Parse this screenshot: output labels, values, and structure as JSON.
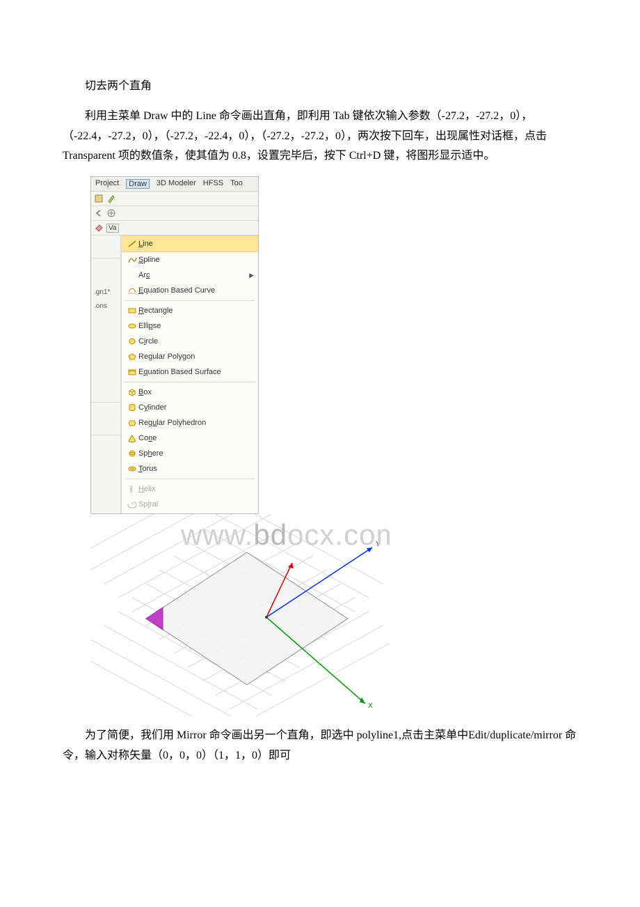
{
  "heading": "切去两个直角",
  "para1": "利用主菜单 Draw 中的 Line 命令画出直角，即利用 Tab 键依次输入参数（-27.2，-27.2，0），（-22.4，-27.2，0），（-27.2，-22.4，0），（-27.2，-27.2，0），两次按下回车，出现属性对话框，点击 Transparent 项的数值条，使其值为 0.8，设置完毕后，按下 Ctrl+D 键，将图形显示适中。",
  "para2": "为了简便，我们用 Mirror 命令画出另一个直角，即选中 polyline1,点击主菜单中Edit/duplicate/mirror 命令，输入对称矢量（0，0，0）（1，1，0）即可",
  "menubar": {
    "items": [
      "Project",
      "Draw",
      "3D Modeler",
      "HFSS",
      "Too"
    ],
    "active_index": 1
  },
  "left_col": {
    "top": [
      "Va"
    ],
    "files": [
      ".gn1*",
      ".ons"
    ]
  },
  "dropdown": {
    "groups": [
      {
        "items": [
          {
            "icon": "line-icon",
            "label": "Line",
            "highlight": true
          },
          {
            "icon": "spline-icon",
            "label": "Spline"
          },
          {
            "icon": "arc-icon",
            "label": "Arc",
            "submenu": true,
            "no_icon": true
          },
          {
            "icon": "eqcurve-icon",
            "label": "Equation Based Curve"
          }
        ]
      },
      {
        "items": [
          {
            "icon": "rect-icon",
            "label": "Rectangle"
          },
          {
            "icon": "ellipse-icon",
            "label": "Ellipse"
          },
          {
            "icon": "circle-icon",
            "label": "Circle"
          },
          {
            "icon": "regpoly-icon",
            "label": "Regular Polygon"
          },
          {
            "icon": "eqsurf-icon",
            "label": "Equation Based Surface"
          }
        ]
      },
      {
        "items": [
          {
            "icon": "box-icon",
            "label": "Box"
          },
          {
            "icon": "cyl-icon",
            "label": "Cylinder"
          },
          {
            "icon": "regpolyh-icon",
            "label": "Regular Polyhedron"
          },
          {
            "icon": "cone-icon",
            "label": "Cone"
          },
          {
            "icon": "sphere-icon",
            "label": "Sphere"
          },
          {
            "icon": "torus-icon",
            "label": "Torus"
          }
        ]
      },
      {
        "items": [
          {
            "icon": "helix-icon",
            "label": "Helix",
            "disabled": true
          },
          {
            "icon": "spiral-icon",
            "label": "Spiral",
            "disabled": true
          }
        ]
      }
    ]
  },
  "viewport": {
    "axes": {
      "x": "X",
      "y": "Y"
    },
    "watermark": "www.bdocx.com"
  }
}
